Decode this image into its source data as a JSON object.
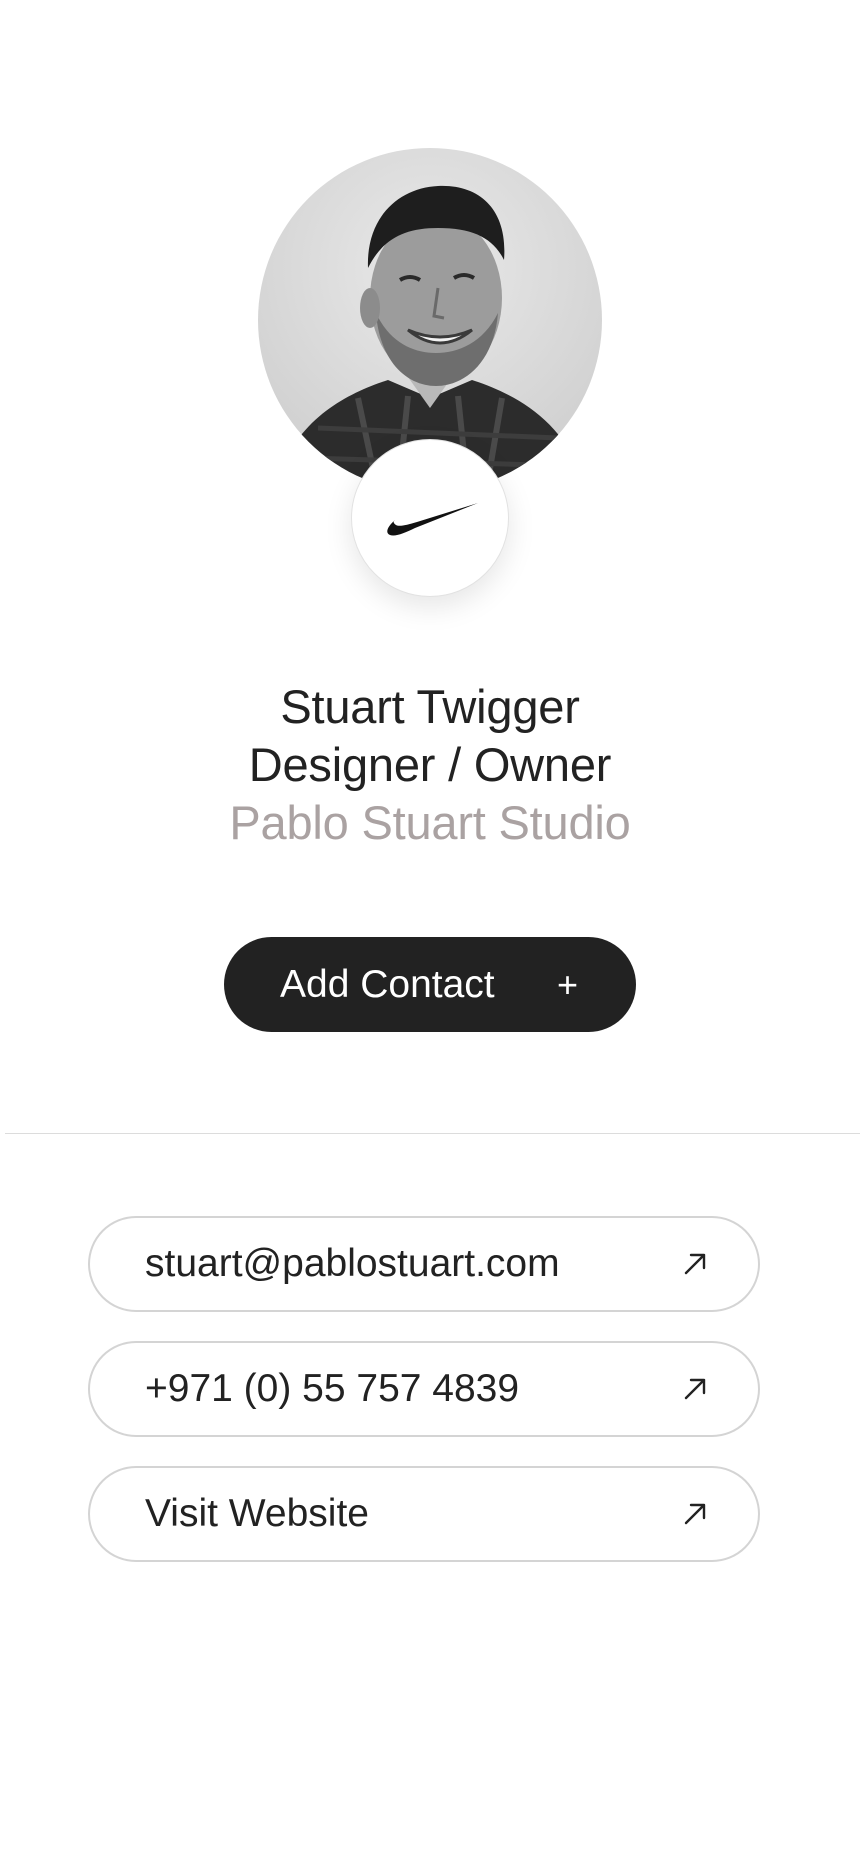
{
  "profile": {
    "name": "Stuart Twigger",
    "role": "Designer / Owner",
    "company": "Pablo Stuart Studio",
    "avatar_icon": "profile-photo",
    "brand_icon": "nike-swoosh-logo"
  },
  "actions": {
    "add_contact_label": "Add Contact",
    "add_contact_icon": "+"
  },
  "links": [
    {
      "label": "stuart@pablostuart.com",
      "icon": "arrow-up-right-icon"
    },
    {
      "label": "+971 (0) 55 757 4839",
      "icon": "arrow-up-right-icon"
    },
    {
      "label": "Visit Website",
      "icon": "arrow-up-right-icon"
    }
  ],
  "colors": {
    "primary_text": "#222222",
    "muted_text": "#aaa2a2",
    "button_bg": "#222222",
    "button_text": "#ffffff",
    "border": "#d4d4d4"
  }
}
